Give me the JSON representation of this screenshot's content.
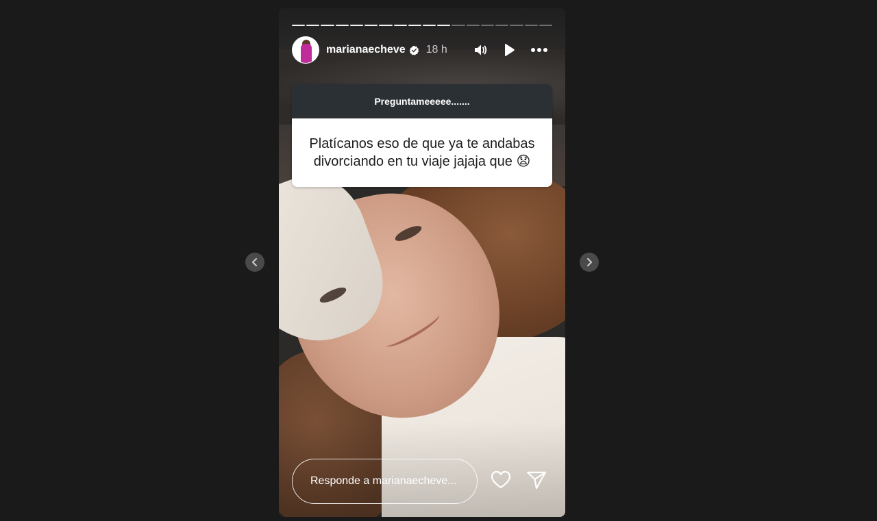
{
  "story": {
    "progress": {
      "segments": 18,
      "completed": 11
    },
    "header": {
      "username": "marianaecheve",
      "verified": true,
      "time": "18 h",
      "icons": [
        "sound-icon",
        "play-icon",
        "more-options-icon"
      ]
    },
    "question_sticker": {
      "title": "Preguntameeeee.......",
      "question": "Platícanos eso de que ya te andabas divorciando en tu viaje jajaja que 😧"
    },
    "reply": {
      "placeholder": "Responde a marianaecheve..."
    },
    "actions": [
      "heart-icon",
      "send-icon"
    ]
  },
  "navigation": {
    "prev_icon": "chevron-left-icon",
    "next_icon": "chevron-right-icon"
  },
  "colors": {
    "background": "#1a1a1a",
    "sticker_header": "#2b3035",
    "sticker_body": "#ffffff",
    "verified": "#ffffff"
  }
}
